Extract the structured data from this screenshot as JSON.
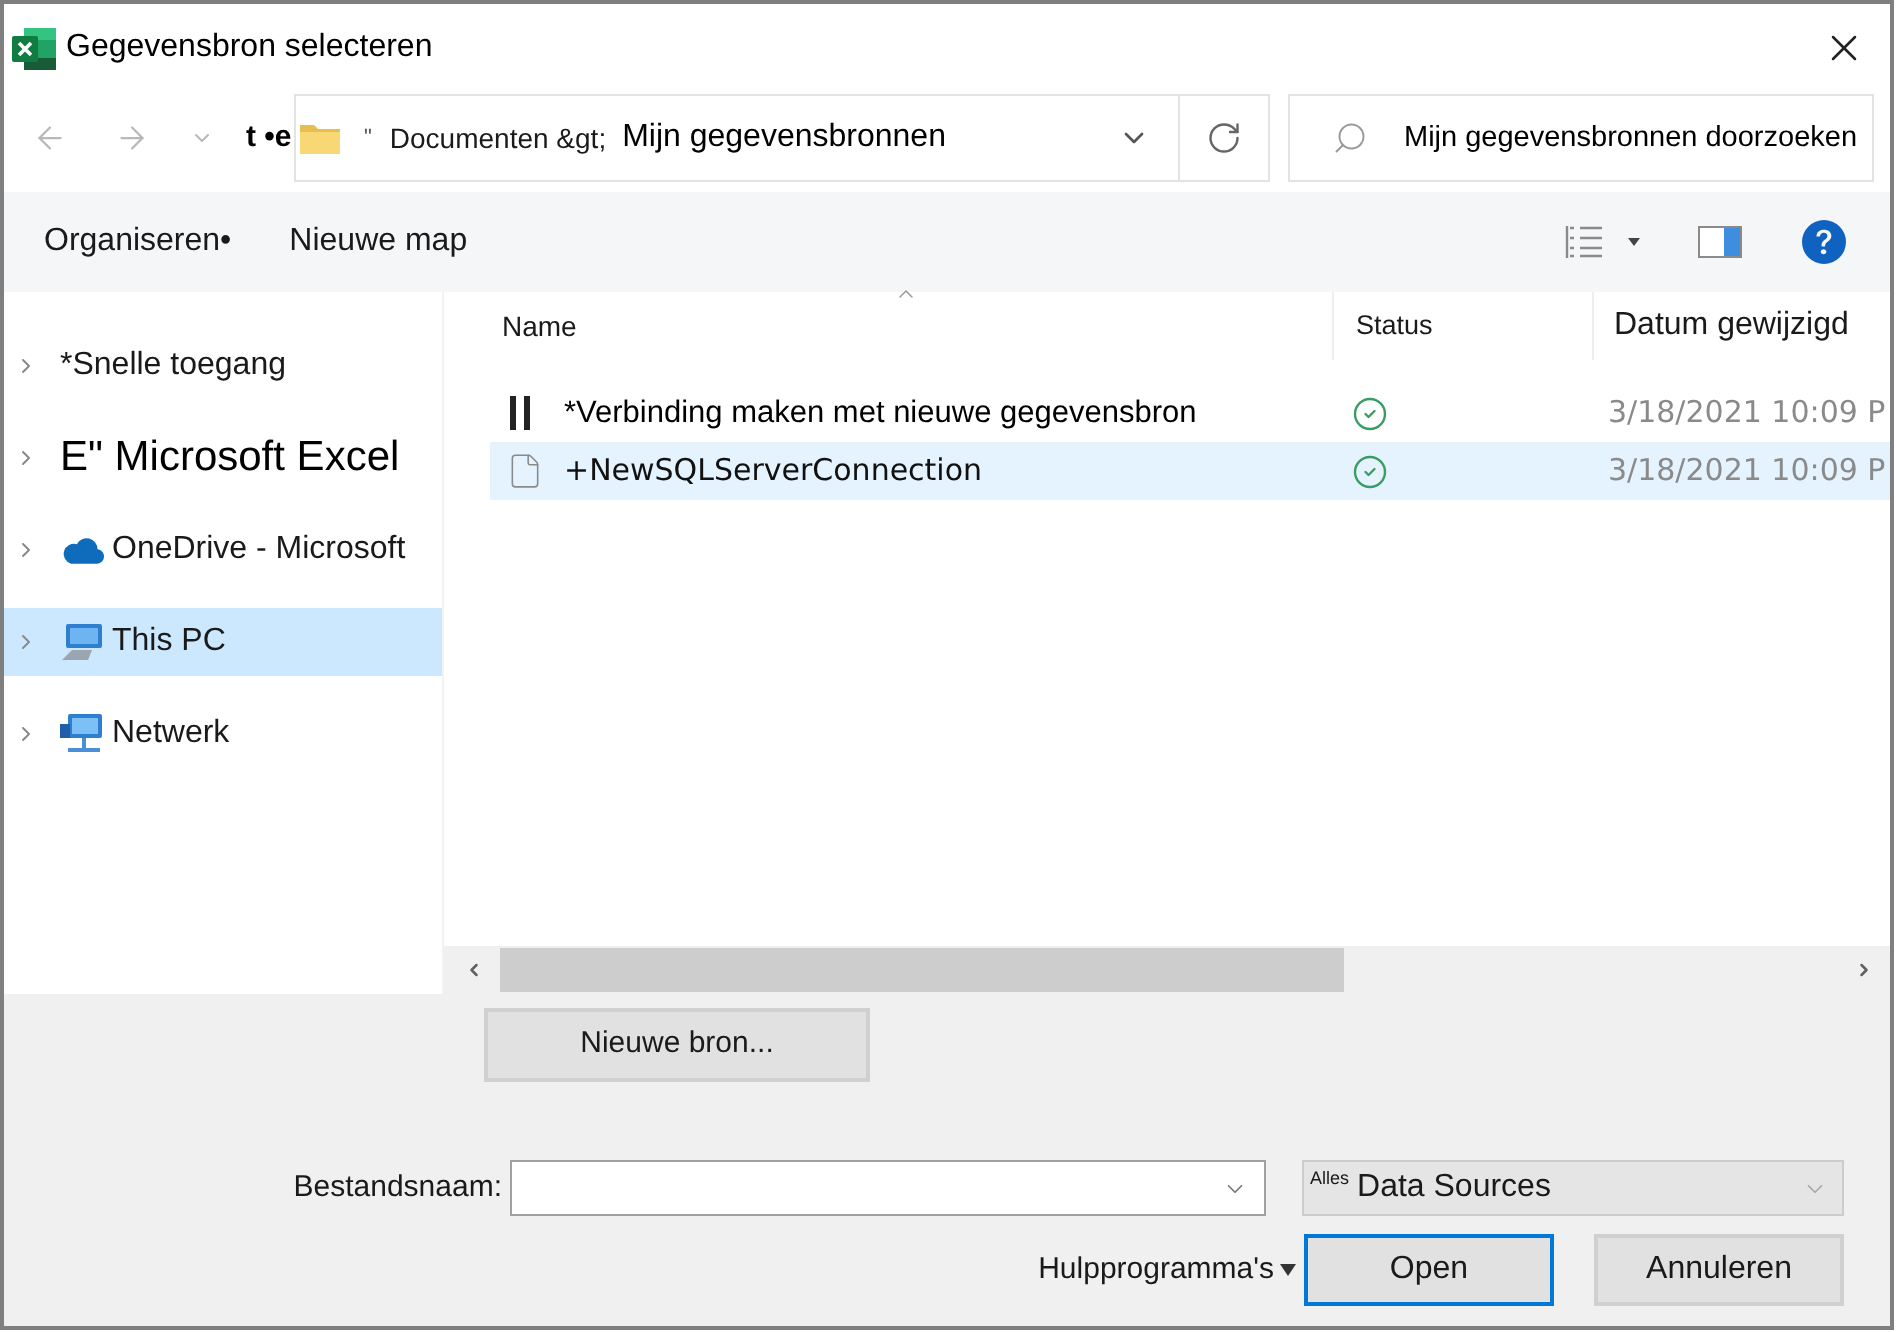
{
  "window": {
    "title": "Gegevensbron selecteren"
  },
  "navigation": {
    "back": {
      "disabled": true
    },
    "forward": {
      "disabled": true
    },
    "label": "t •e"
  },
  "address_bar": {
    "separator": "\"",
    "segments": [
      {
        "text": "Documenten &gt;",
        "current": false
      },
      {
        "text": "Mijn gegevensbronnen",
        "current": true
      }
    ]
  },
  "search": {
    "placeholder": "Mijn gegevensbronnen doorzoeken"
  },
  "toolbar": {
    "items": [
      "Organiseren•",
      "Nieuwe map"
    ]
  },
  "sidebar": {
    "items": [
      {
        "label": "*Snelle toegang",
        "kind": "plain",
        "expanded": false,
        "selected": false
      },
      {
        "label": "E\" Microsoft Excel",
        "kind": "large",
        "expanded": false,
        "selected": false
      },
      {
        "label": "OneDrive - Microsoft",
        "kind": "cloud",
        "expanded": false,
        "selected": false
      },
      {
        "label": "This PC",
        "kind": "computer",
        "expanded": false,
        "selected": true
      },
      {
        "label": "Netwerk",
        "kind": "network",
        "expanded": false,
        "selected": false
      }
    ]
  },
  "file_list": {
    "columns": [
      {
        "label": "Name",
        "sorted": true
      },
      {
        "label": "Status",
        "sorted": false
      },
      {
        "label": "Datum gewijzigd",
        "sorted": false
      }
    ],
    "rows": [
      {
        "kind": "action",
        "name": "*Verbinding maken met nieuwe gegevensbron",
        "status_ok": true,
        "date": "3/18/2021 10:09 P",
        "selected": false
      },
      {
        "kind": "file",
        "name": "+NewSQLServerConnection",
        "status_ok": true,
        "date": "3/18/2021 10:09 P",
        "selected": true
      }
    ]
  },
  "new_source_button": {
    "label": "Nieuwe bron..."
  },
  "file_name": {
    "label": "Bestandsnaam:"
  },
  "file_type": {
    "prefix": "Alles",
    "value": "Data Sources"
  },
  "tools_menu": {
    "label": "Hulpprogramma's"
  },
  "buttons": [
    {
      "label": "Open",
      "default": true
    },
    {
      "label": "Annuleren",
      "default": false
    }
  ]
}
